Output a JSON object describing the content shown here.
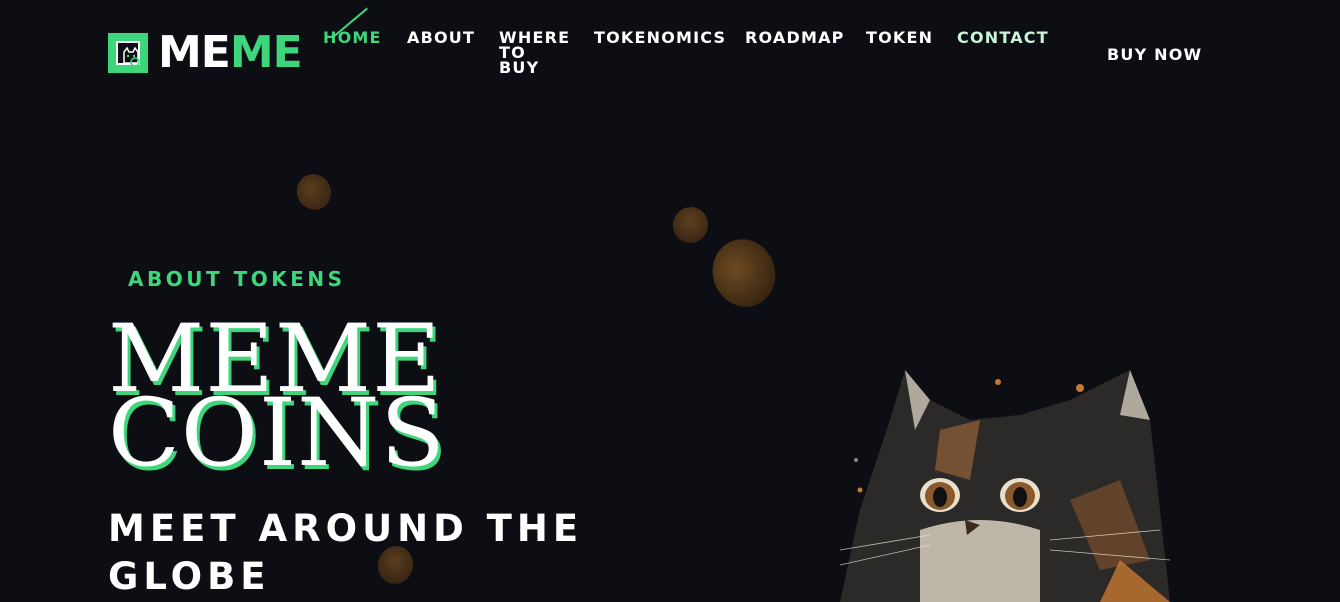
{
  "brand": {
    "name_white": "ME",
    "name_green": "ME",
    "accent_color": "#3ed67c",
    "logo_icon": "cat-logo-icon"
  },
  "nav": {
    "items": [
      {
        "label": "HOME",
        "active": true
      },
      {
        "label": "ABOUT"
      },
      {
        "label": "WHERE TO BUY"
      },
      {
        "label": "TOKENOMICS"
      },
      {
        "label": "ROADMAP"
      },
      {
        "label": "TOKEN"
      },
      {
        "label": "CONTACT"
      }
    ],
    "cta": "BUY NOW"
  },
  "hero": {
    "kicker": "ABOUT TOKENS",
    "title_line1": "MEME",
    "title_line2": "COINS",
    "subtitle": "MEET AROUND THE GLOBE",
    "image": "cat-illustration",
    "decor": "coin-icon"
  }
}
